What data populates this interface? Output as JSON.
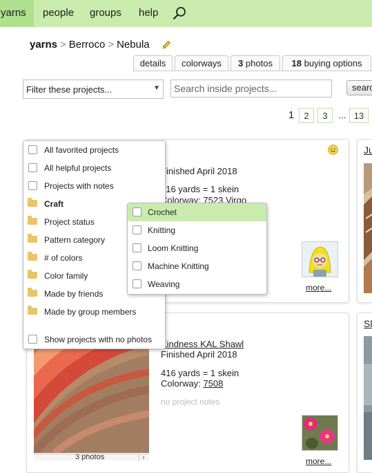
{
  "nav": {
    "items": [
      "yarns",
      "people",
      "groups",
      "help"
    ],
    "active": "yarns"
  },
  "breadcrumb": {
    "root": "yarns",
    "brand": "Berroco",
    "yarn": "Nebula",
    "separator": ">"
  },
  "tabs": [
    {
      "label": "details"
    },
    {
      "label": "colorways"
    },
    {
      "count": "3",
      "label": "photos"
    },
    {
      "count": "18",
      "label": "buying options"
    }
  ],
  "filter": {
    "select_value": "Filter these projects...",
    "search_placeholder": "Search inside projects...",
    "search_button": "search"
  },
  "pagination": {
    "current": "1",
    "pages": [
      "2",
      "3"
    ],
    "ellipsis": "...",
    "last": "13"
  },
  "cards": [
    {
      "finished": "Finished April 2018",
      "yardage": "416 yards = 1 skein",
      "colorway_label": "Colorway:",
      "colorway": "7523 Virgo",
      "more": "more..."
    },
    {
      "title": "Kindness KAL Shawl",
      "finished": "Finished April 2018",
      "yardage": "416 yards = 1 skein",
      "colorway_label": "Colorway:",
      "colorway": "7508",
      "notes": "no project notes",
      "photos": "3 photos",
      "more": "more..."
    }
  ],
  "side_cards": [
    {
      "title_fragment": "Ju"
    },
    {
      "title_fragment": "Sl"
    }
  ],
  "filter_menu": {
    "checkbox_items": [
      "All favorited projects",
      "All helpful projects",
      "Projects with notes"
    ],
    "folder_items": [
      "Craft",
      "Project status",
      "Pattern category",
      "# of colors",
      "Color family",
      "Made by friends",
      "Made by group members"
    ],
    "bottom_item": "Show projects with no photos"
  },
  "craft_menu": {
    "items": [
      "Crochet",
      "Knitting",
      "Loom Knitting",
      "Machine Knitting",
      "Weaving"
    ],
    "highlighted": "Crochet"
  },
  "colors": {
    "nav_bg": "#c9ecae",
    "nav_active": "#aee08d",
    "highlight": "#c9ecae",
    "page_box_border": "#bfe3a6"
  }
}
